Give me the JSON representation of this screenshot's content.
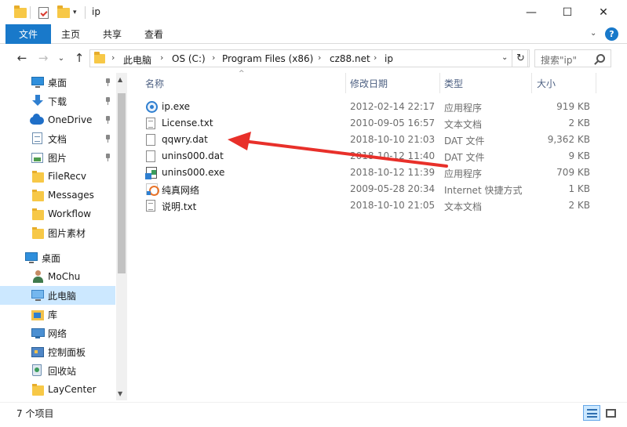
{
  "window": {
    "title": "ip",
    "minimize": "—",
    "maximize": "☐",
    "close": "✕"
  },
  "ribbon": {
    "tabs": [
      "文件",
      "主页",
      "共享",
      "查看"
    ],
    "expand_glyph": "⌄",
    "help_glyph": "?"
  },
  "nav": {
    "back": "←",
    "forward": "→",
    "recent": "⌄",
    "up": "↑"
  },
  "address": {
    "crumbs": [
      "此电脑",
      "OS (C:)",
      "Program Files (x86)",
      "cz88.net",
      "ip"
    ],
    "separator": "›",
    "dropdown": "⌄",
    "refresh": "↻"
  },
  "search": {
    "placeholder": "搜索\"ip\""
  },
  "sidebar": {
    "items": [
      {
        "label": "桌面",
        "icon": "desktop-icon",
        "pinned": true
      },
      {
        "label": "下载",
        "icon": "download-icon",
        "pinned": true
      },
      {
        "label": "OneDrive",
        "icon": "onedrive-icon",
        "pinned": true
      },
      {
        "label": "文档",
        "icon": "documents-icon",
        "pinned": true
      },
      {
        "label": "图片",
        "icon": "pictures-icon",
        "pinned": true
      },
      {
        "label": "FileRecv",
        "icon": "folder-icon",
        "pinned": false
      },
      {
        "label": "Messages",
        "icon": "folder-icon",
        "pinned": false
      },
      {
        "label": "Workflow",
        "icon": "folder-icon",
        "pinned": false
      },
      {
        "label": "图片素材",
        "icon": "folder-icon",
        "pinned": false
      },
      {
        "label": "桌面",
        "icon": "desktop-icon",
        "pinned": false
      },
      {
        "label": "MoChu",
        "icon": "user-icon",
        "pinned": false
      },
      {
        "label": "此电脑",
        "icon": "this-pc-icon",
        "pinned": false,
        "selected": true
      },
      {
        "label": "库",
        "icon": "library-icon",
        "pinned": false
      },
      {
        "label": "网络",
        "icon": "network-icon",
        "pinned": false
      },
      {
        "label": "控制面板",
        "icon": "control-panel-icon",
        "pinned": false
      },
      {
        "label": "回收站",
        "icon": "recycle-bin-icon",
        "pinned": false
      },
      {
        "label": "LayCenter",
        "icon": "folder-icon",
        "pinned": false
      }
    ]
  },
  "filelist": {
    "columns": {
      "name": "名称",
      "date": "修改日期",
      "type": "类型",
      "size": "大小"
    },
    "sort_glyph": "^",
    "rows": [
      {
        "name": "ip.exe",
        "date": "2012-02-14 22:17",
        "type": "应用程序",
        "size": "919 KB",
        "icon": "ip-exe-icon"
      },
      {
        "name": "License.txt",
        "date": "2010-09-05 16:57",
        "type": "文本文档",
        "size": "2 KB",
        "icon": "text-file-icon"
      },
      {
        "name": "qqwry.dat",
        "date": "2018-10-10 21:03",
        "type": "DAT 文件",
        "size": "9,362 KB",
        "icon": "blank-file-icon"
      },
      {
        "name": "unins000.dat",
        "date": "2018-10-12 11:40",
        "type": "DAT 文件",
        "size": "9 KB",
        "icon": "blank-file-icon"
      },
      {
        "name": "unins000.exe",
        "date": "2018-10-12 11:39",
        "type": "应用程序",
        "size": "709 KB",
        "icon": "uninstaller-icon"
      },
      {
        "name": "纯真网络",
        "date": "2009-05-28 20:34",
        "type": "Internet 快捷方式",
        "size": "1 KB",
        "icon": "internet-shortcut-icon"
      },
      {
        "name": "说明.txt",
        "date": "2018-10-10 21:05",
        "type": "文本文档",
        "size": "2 KB",
        "icon": "text-file-icon"
      }
    ]
  },
  "annotation": {
    "color": "#e8302a"
  },
  "status": {
    "item_count": "7 个项目"
  },
  "colors": {
    "accent": "#1979ca",
    "selection": "#cce8ff"
  }
}
